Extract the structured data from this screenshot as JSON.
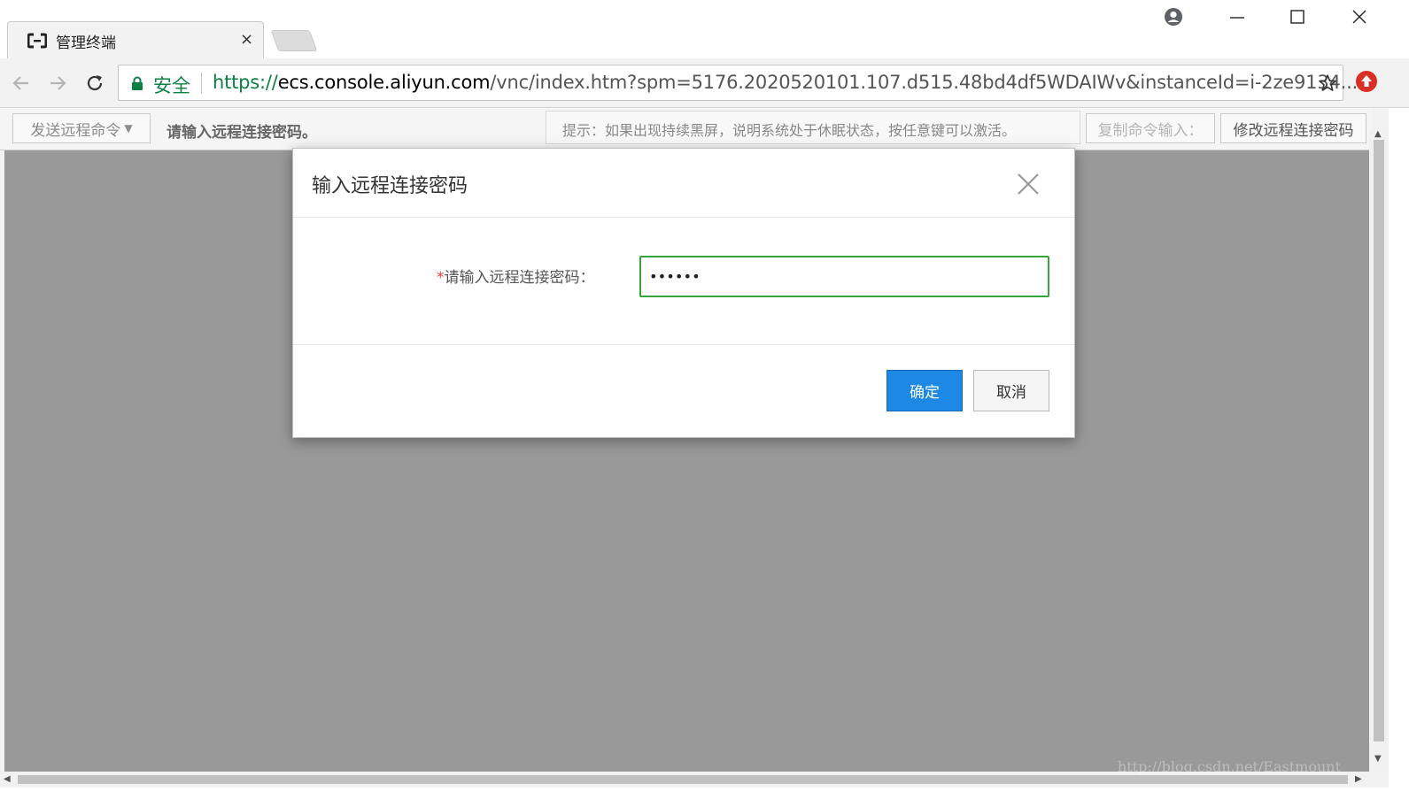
{
  "browser": {
    "tab_title": "管理终端",
    "tab_close": "×",
    "secure_label": "安全",
    "url_scheme": "https://",
    "url_host": "ecs.console.aliyun.com",
    "url_path": "/vnc/index.htm?spm=5176.2020520101.107.d515.48bd4df5WDAIWv&instanceId=i-2ze9134...",
    "icons": [
      "aliyun-favicon",
      "profile-icon",
      "minimize-icon",
      "maximize-icon",
      "close-window-icon",
      "back-icon",
      "forward-icon",
      "reload-icon",
      "lock-icon",
      "star-icon",
      "extension-icon"
    ]
  },
  "vnc_toolbar": {
    "send_command": "发送远程命令",
    "password_prompt": "请输入远程连接密码。",
    "tip": "提示：如果出现持续黑屏，说明系统处于休眠状态，按任意键可以激活。",
    "copy_command": "复制命令输入：",
    "change_password": "修改远程连接密码"
  },
  "dialog": {
    "title": "输入远程连接密码",
    "required_mark": "*",
    "field_label": "请输入远程连接密码：",
    "password_value": "••••••",
    "ok_label": "确定",
    "cancel_label": "取消"
  },
  "watermark": "http://blog.csdn.net/Eastmount",
  "colors": {
    "secure_green": "#0b8043",
    "screen_gray": "#999999",
    "input_focus_green": "#34a43b",
    "primary_blue": "#1e88e5",
    "required_red": "#e4393c"
  }
}
